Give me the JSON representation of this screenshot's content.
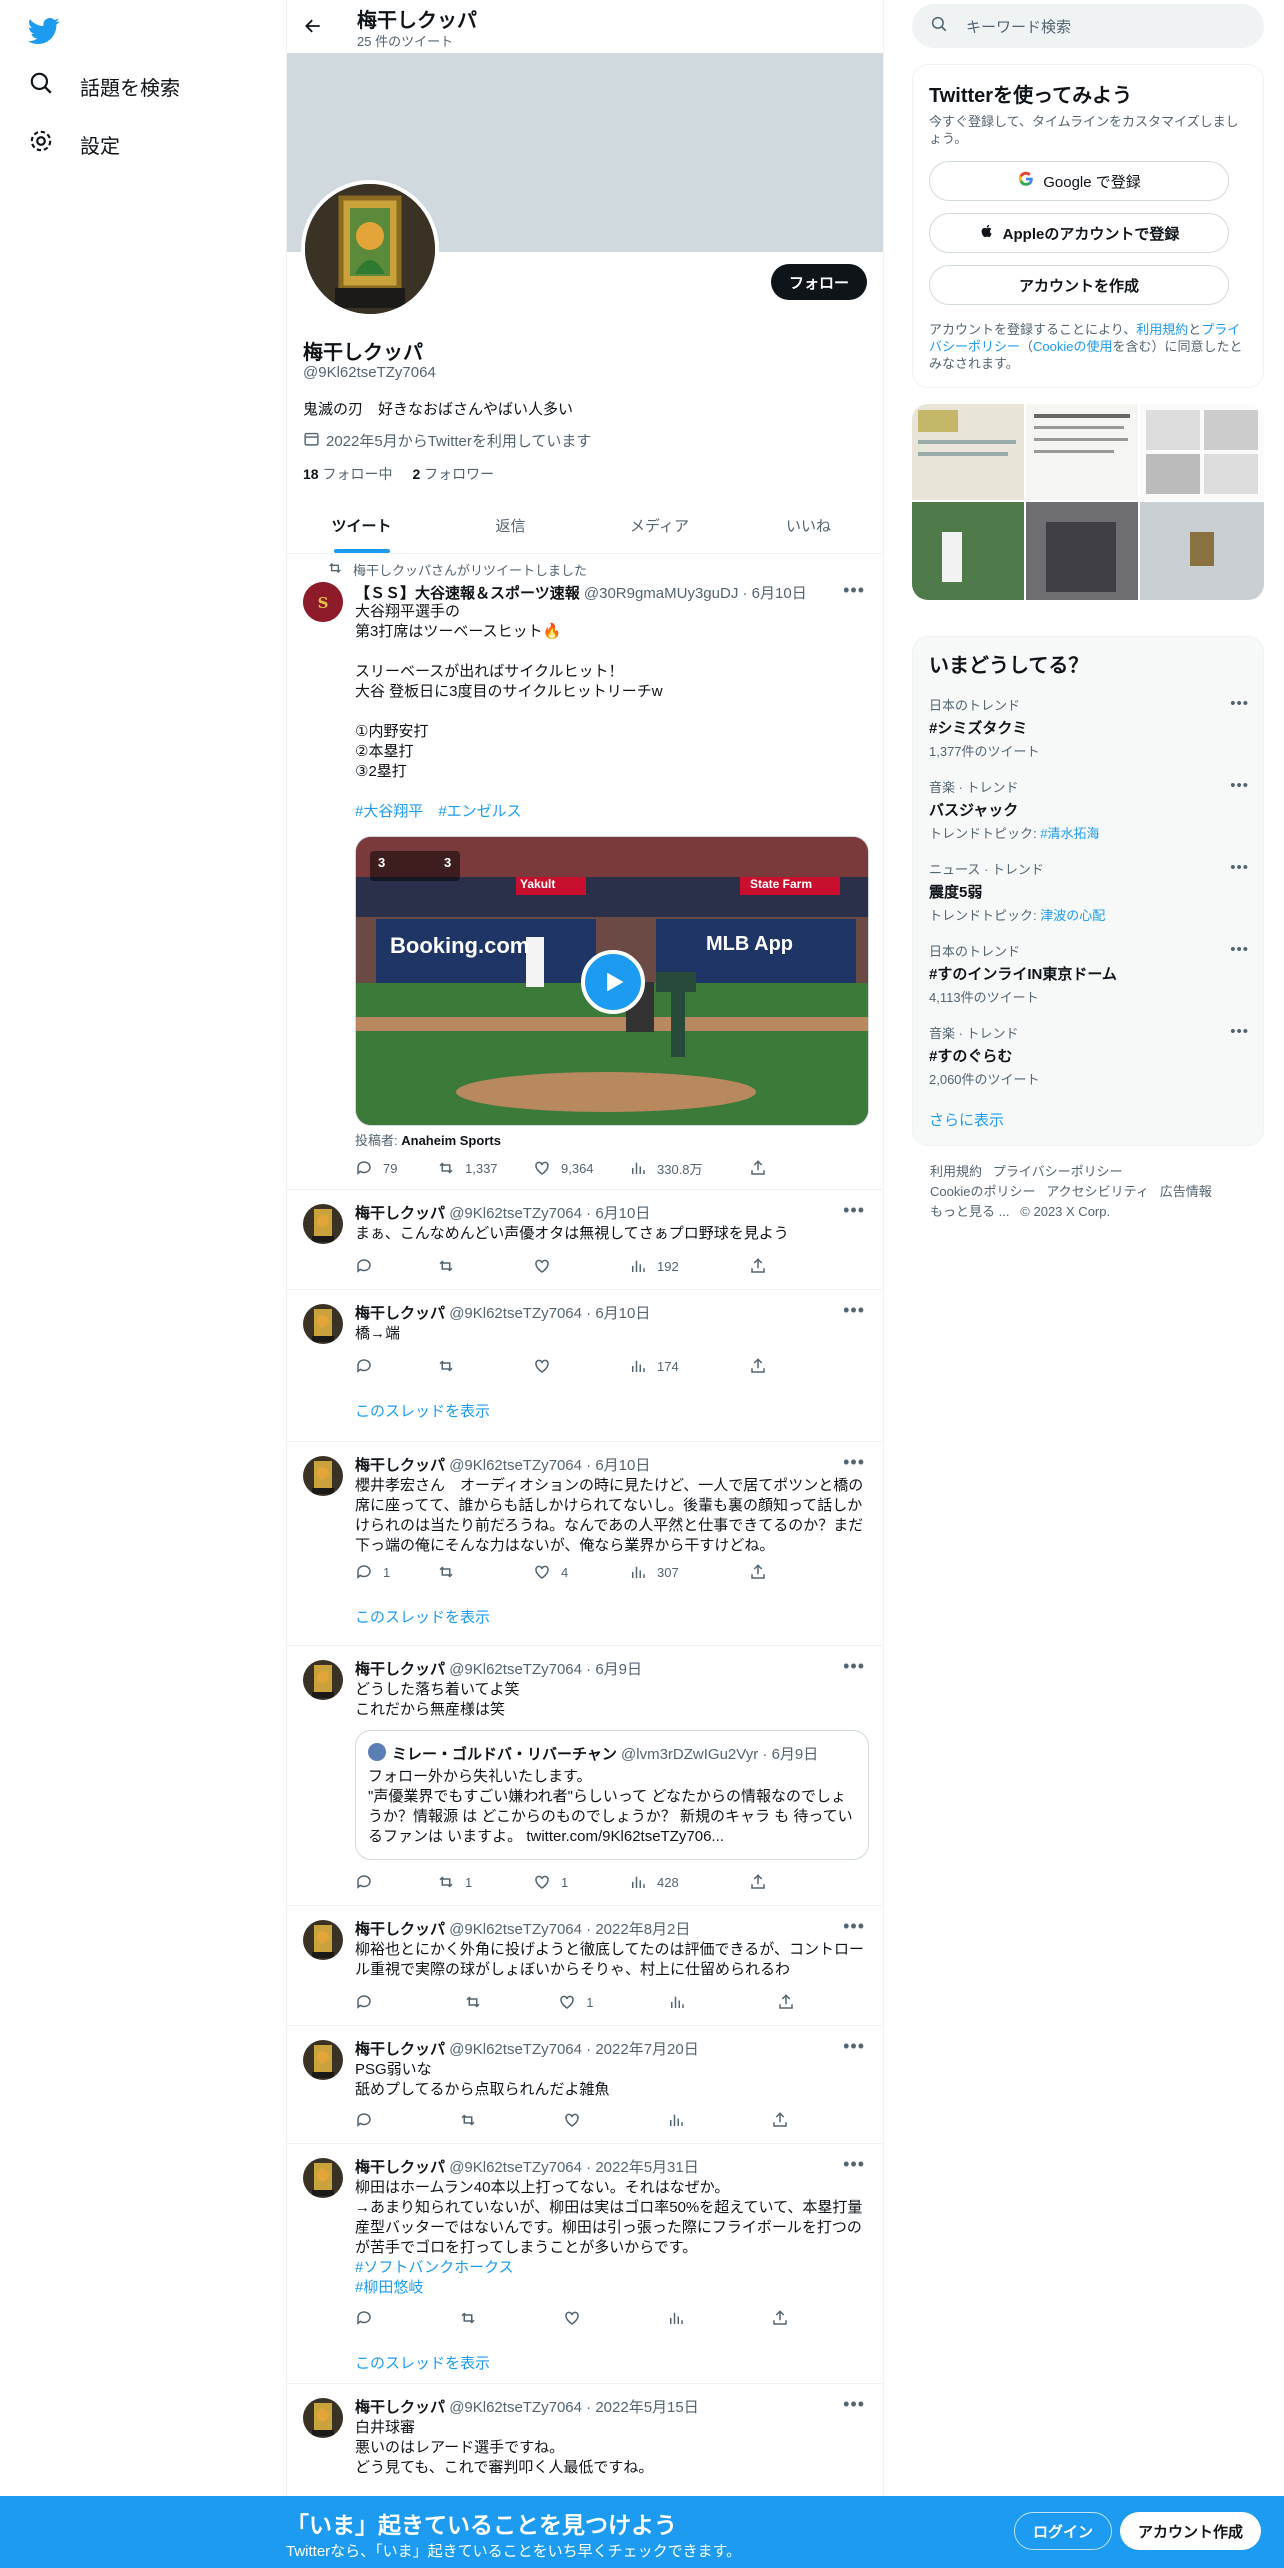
{
  "left_nav": {
    "explore": "話題を検索",
    "settings": "設定"
  },
  "profile": {
    "header_name": "梅干しクッパ",
    "tweet_count": "25 件のツイート",
    "display_name": "梅干しクッパ",
    "handle": "@9Kl62tseTZy7064",
    "bio": "鬼滅の刃　好きなおばさんやばい人多い",
    "joined": "2022年5月からTwitterを利用しています",
    "following_count": "18",
    "following_label": "フォロー中",
    "followers_count": "2",
    "followers_label": "フォロワー",
    "follow_button": "フォロー"
  },
  "tabs": [
    "ツイート",
    "返信",
    "メディア",
    "いいね"
  ],
  "tweets": [
    {
      "retweet_note": "梅干しクッパさんがリツイートしました",
      "name": "【ＳＳ】大谷速報＆スポーツ速報",
      "handle": "@30R9gmaMUy3guDJ",
      "date": "6月10日",
      "text": "大谷翔平選手の\n第3打席はツーベースヒット🔥\n\nスリーベースが出ればサイクルヒット！\n大谷 登板日に3度目のサイクルヒットリーチw\n\n①内野安打\n②本塁打\n③2塁打",
      "hashtags": "#大谷翔平　#エンゼルス",
      "video_credit_label": "投稿者:",
      "video_credit": "Anaheim Sports",
      "video_texts": {
        "banner1": "Booking.com",
        "banner2": "MLB App",
        "sign1": "Yakult",
        "sign2": "State Farm",
        "score": "3",
        "score2": "3"
      },
      "replies": "79",
      "retweets": "1,337",
      "likes": "9,364",
      "views": "330.8万"
    },
    {
      "name": "梅干しクッパ",
      "handle": "@9Kl62tseTZy7064",
      "date": "6月10日",
      "text": "まぁ、こんなめんどい声優オタは無視してさぁプロ野球を見よう",
      "replies": "",
      "retweets": "",
      "likes": "",
      "views": "192"
    },
    {
      "name": "梅干しクッパ",
      "handle": "@9Kl62tseTZy7064",
      "date": "6月10日",
      "text": "橋→端",
      "replies": "",
      "retweets": "",
      "likes": "",
      "views": "174",
      "thread": "このスレッドを表示"
    },
    {
      "name": "梅干しクッパ",
      "handle": "@9Kl62tseTZy7064",
      "date": "6月10日",
      "text": "櫻井孝宏さん　オーディオションの時に見たけど、一人で居てポツンと橋の席に座ってて、誰からも話しかけられてないし。後輩も裏の顔知って話しかけられのは当たり前だろうね。なんであの人平然と仕事できてるのか？まだ下っ端の俺にそんな力はないが、俺なら業界から干すけどね。",
      "replies": "1",
      "retweets": "",
      "likes": "4",
      "views": "307",
      "thread": "このスレッドを表示"
    },
    {
      "name": "梅干しクッパ",
      "handle": "@9Kl62tseTZy7064",
      "date": "6月9日",
      "text": "どうした落ち着いてよ笑\nこれだから無産様は笑",
      "quote": {
        "name": "ミレー・ゴルドバ・リバーチャン",
        "handle": "@lvm3rDZwIGu2Vyr",
        "date": "6月9日",
        "text": "フォロー外から失礼いたします。\n\"声優業界でもすごい嫌われ者\"らしいって どなたからの情報なのでしょうか？情報源 は どこからのものでしょうか？ 新規のキャラ も 待っているファンは いますよ。 twitter.com/9Kl62tseTZy706..."
      },
      "replies": "",
      "retweets": "1",
      "likes": "1",
      "views": "428"
    },
    {
      "name": "梅干しクッパ",
      "handle": "@9Kl62tseTZy7064",
      "date": "2022年8月2日",
      "text": "柳裕也とにかく外角に投げようと徹底してたのは評価できるが、コントロール重視で実際の球がしょぼいからそりゃ、村上に仕留められるわ",
      "replies": "",
      "retweets": "",
      "likes": "1",
      "views": ""
    },
    {
      "name": "梅干しクッパ",
      "handle": "@9Kl62tseTZy7064",
      "date": "2022年7月20日",
      "text": "PSG弱いな\n舐めプしてるから点取られんだよ雑魚",
      "replies": "",
      "retweets": "",
      "likes": "",
      "views": ""
    },
    {
      "name": "梅干しクッパ",
      "handle": "@9Kl62tseTZy7064",
      "date": "2022年5月31日",
      "text": "柳田はホームラン40本以上打ってない。それはなぜか。\n→あまり知られていないが、柳田は実はゴロ率50%を超えていて、本塁打量産型バッターではないんです。柳田は引っ張った際にフライボールを打つのが苦手でゴロを打ってしまうことが多いからです。",
      "hashtag1": "#ソフトバンクホークス",
      "hashtag2": "#柳田悠岐",
      "replies": "",
      "retweets": "",
      "likes": "",
      "views": "",
      "thread": "このスレッドを表示"
    },
    {
      "name": "梅干しクッパ",
      "handle": "@9Kl62tseTZy7064",
      "date": "2022年5月15日",
      "text": "白井球審\n悪いのはレアード選手ですね。\nどう見ても、これで審判叩く人最低ですね。"
    }
  ],
  "right": {
    "search_placeholder": "キーワード検索",
    "signup": {
      "title": "Twitterを使ってみよう",
      "subtitle": "今すぐ登録して、タイムラインをカスタマイズしましょう。",
      "google": "Google で登録",
      "apple": "Appleのアカウントで登録",
      "create": "アカウントを作成",
      "terms_pre": "アカウントを登録することにより、",
      "terms_link": "利用規約",
      "terms_and": "と",
      "privacy_link": "プライバシーポリシー",
      "cookie_pre": "（",
      "cookie_link": "Cookieの使用",
      "terms_post": "を含む）に同意したとみなされます。"
    },
    "trends_title": "いまどうしてる？",
    "trends": [
      {
        "context": "日本のトレンド",
        "name": "#シミズタクミ",
        "sub": "1,377件のツイート",
        "link": ""
      },
      {
        "context": "音楽 · トレンド",
        "name": "バスジャック",
        "sub": "トレンドトピック: ",
        "link": "#清水拓海"
      },
      {
        "context": "ニュース · トレンド",
        "name": "震度5弱",
        "sub": "トレンドトピック: ",
        "link": "津波の心配"
      },
      {
        "context": "日本のトレンド",
        "name": "#すのインライIN東京ドーム",
        "sub": "4,113件のツイート",
        "link": ""
      },
      {
        "context": "音楽 · トレンド",
        "name": "#すのぐらむ",
        "sub": "2,060件のツイート",
        "link": ""
      }
    ],
    "show_more": "さらに表示",
    "footer": [
      "利用規約",
      "プライバシーポリシー",
      "Cookieのポリシー",
      "アクセシビリティ",
      "広告情報",
      "もっと見る ...",
      "© 2023 X Corp."
    ]
  },
  "bottom_bar": {
    "title": "「いま」起きていることを見つけよう",
    "subtitle": "Twitterなら、「いま」起きていることをいち早くチェックできます。",
    "login": "ログイン",
    "signup": "アカウント作成"
  },
  "colors": {
    "accent": "#1d9bf0",
    "text": "#0f1419",
    "muted": "#536471"
  }
}
